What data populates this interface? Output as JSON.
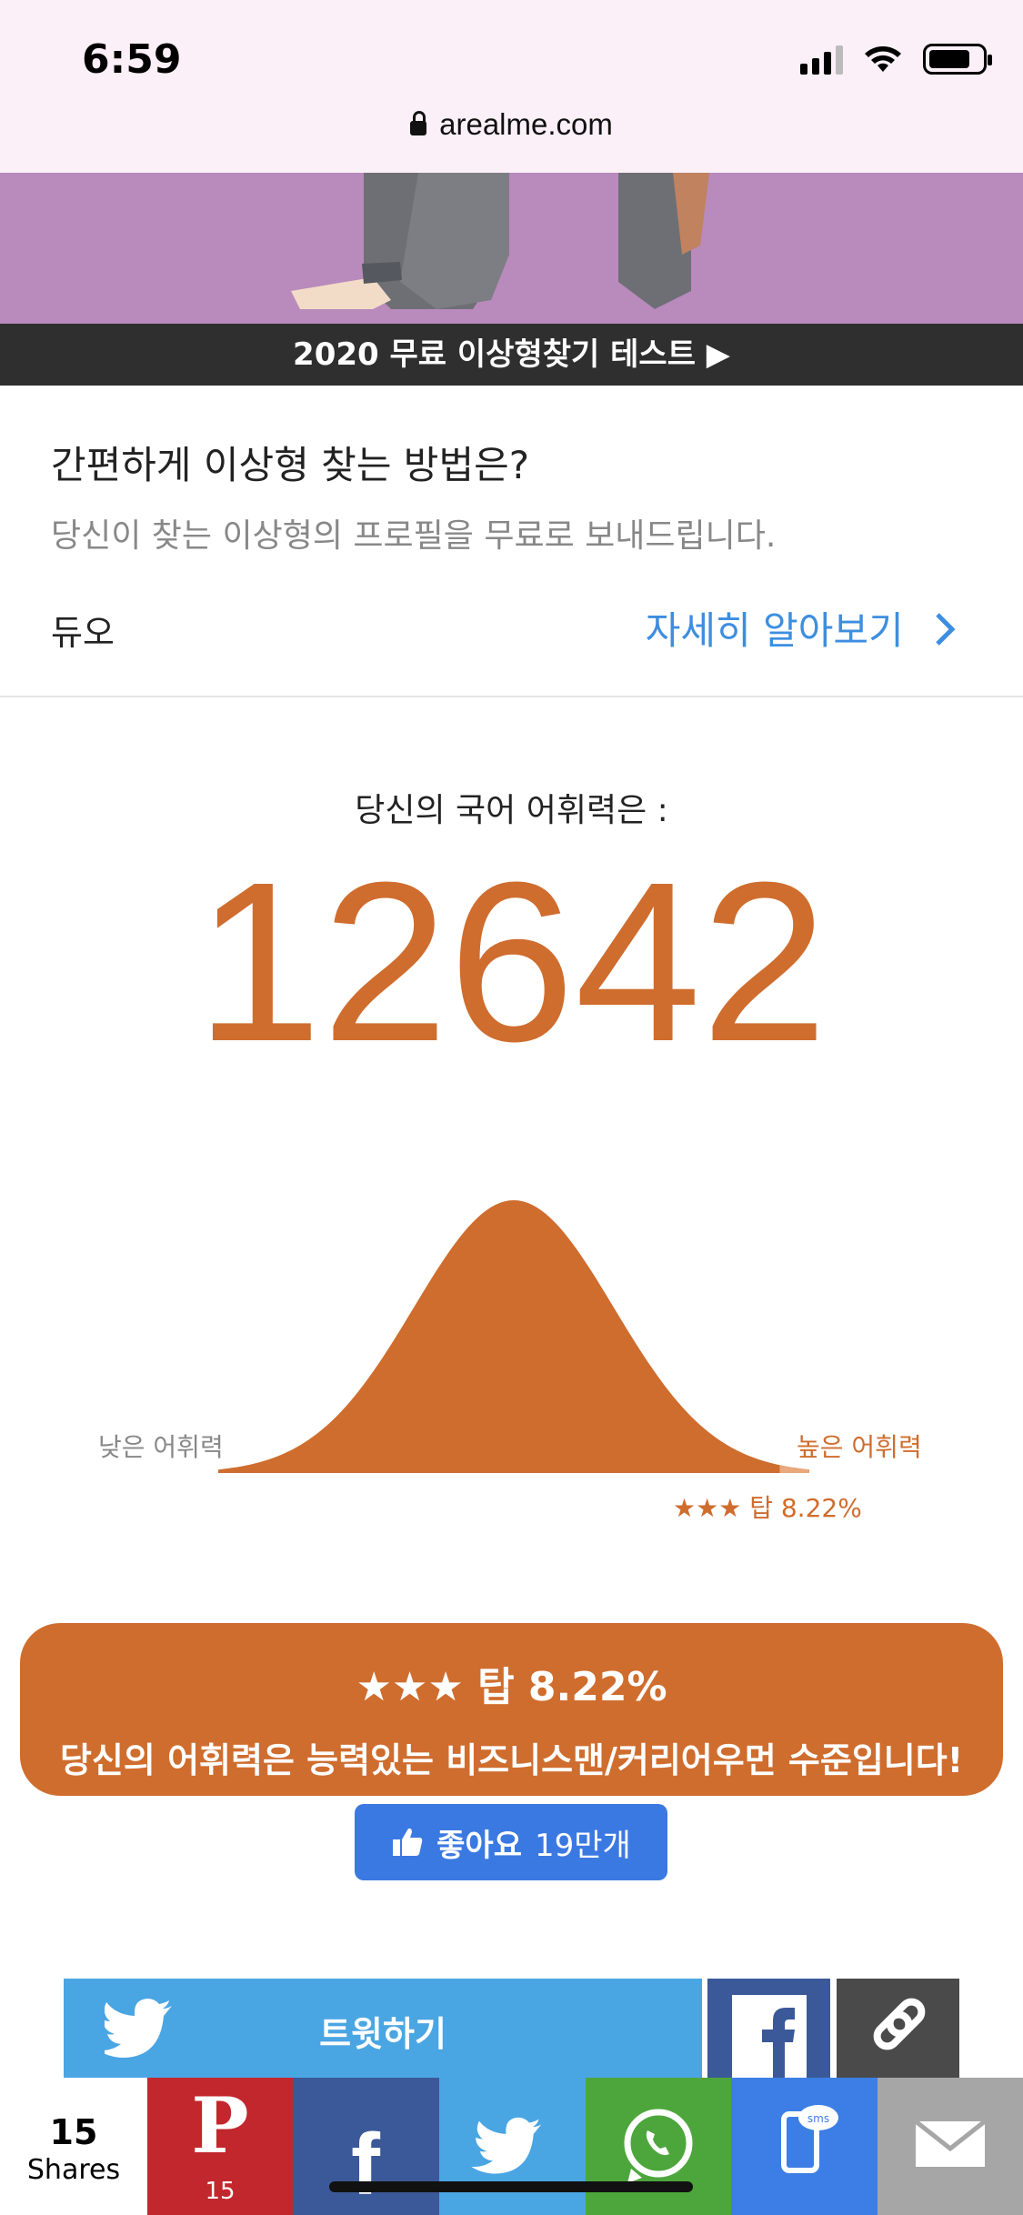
{
  "status_bar": {
    "time": "6:59"
  },
  "browser": {
    "url": "arealme.com"
  },
  "ad": {
    "banner_text": "2020 무료 이상형찾기 테스트 ▶",
    "title": "간편하게 이상형 찾는 방법은?",
    "subtitle": "당신이 찾는 이상형의 프로필을 무료로 보내드립니다.",
    "brand": "듀오",
    "cta": "자세히 알아보기"
  },
  "result": {
    "label": "당신의 국어 어휘력은 :",
    "score": "12642",
    "low_label": "낮은 어휘력",
    "high_label": "높은 어휘력",
    "rank_label": "★★★ 탑 8.22%",
    "top_percent": 8.22,
    "box_line1": "★★★ 탑 8.22%",
    "box_line2": "당신의 어휘력은 능력있는 비즈니스맨/커리어우먼 수준입니다!"
  },
  "like_button": {
    "label": "좋아요",
    "count": "19만개"
  },
  "share": {
    "tweet_label": "트윗하기",
    "shares_count": "15",
    "shares_label": "Shares",
    "pinterest_count": "15"
  },
  "colors": {
    "accent": "#cf6d2e",
    "ad_link": "#3d8ee0",
    "like": "#3b79e2",
    "twitter": "#4aa5e3",
    "facebook": "#3b5998",
    "pinterest": "#c2272d",
    "whatsapp": "#4da63c",
    "sms": "#3d7ee6",
    "email": "#a6a6a6"
  }
}
